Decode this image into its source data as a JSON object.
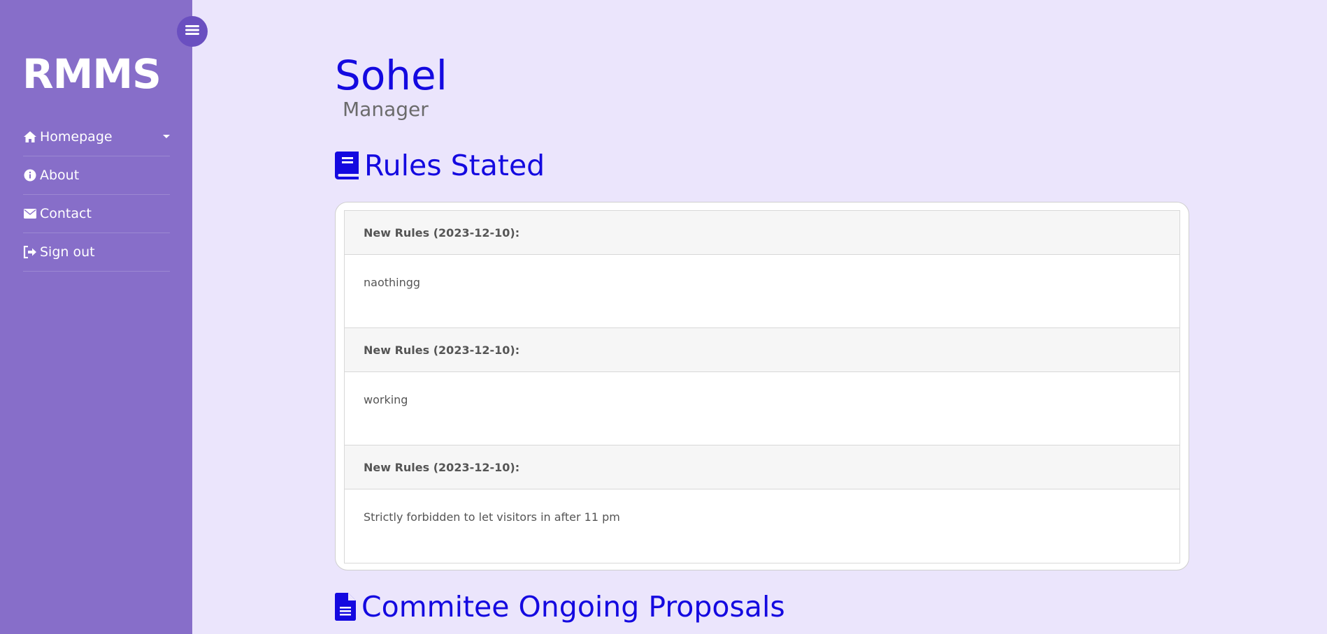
{
  "sidebar": {
    "brand": "RMMS",
    "items": [
      {
        "label": "Homepage",
        "icon": "home-icon"
      },
      {
        "label": "About",
        "icon": "info-icon"
      },
      {
        "label": "Contact",
        "icon": "envelope-icon"
      },
      {
        "label": "Sign out",
        "icon": "sign-out-icon"
      }
    ]
  },
  "user": {
    "name": "Sohel",
    "role": "Manager"
  },
  "rules": {
    "title": "Rules Stated",
    "icon": "book-icon",
    "items": [
      {
        "header": "New Rules (2023-12-10):",
        "body": "naothingg"
      },
      {
        "header": "New Rules (2023-12-10):",
        "body": "working"
      },
      {
        "header": "New Rules (2023-12-10):",
        "body": "Strictly forbidden to let visitors in after 11 pm"
      }
    ]
  },
  "proposals": {
    "title": "Commitee Ongoing Proposals",
    "icon": "document-icon"
  },
  "colors": {
    "sidebar": "#876ec9",
    "background": "#ebe5fc",
    "accent": "#1409e0"
  }
}
